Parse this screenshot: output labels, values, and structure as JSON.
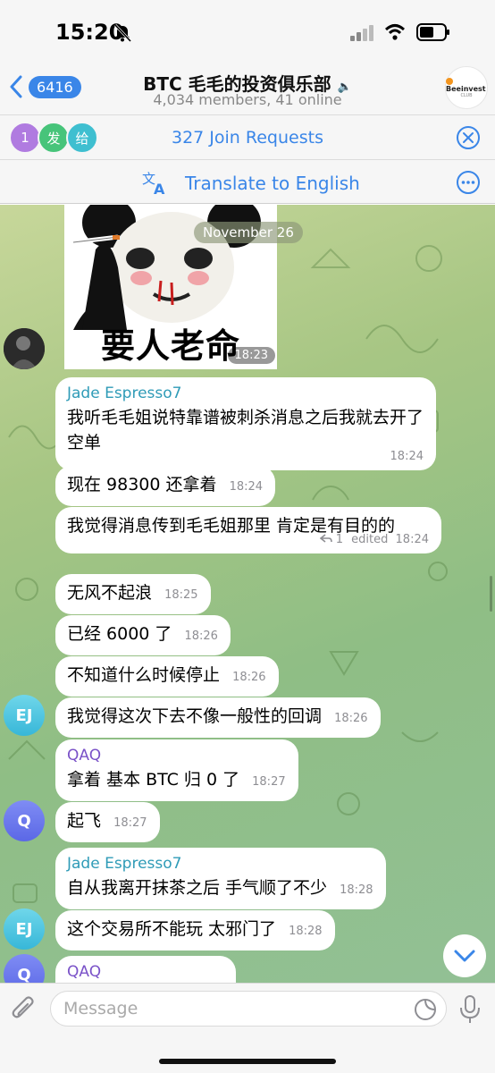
{
  "status": {
    "time": "15:20"
  },
  "header": {
    "back_count": "6416",
    "title": "BTC 毛毛的投资俱乐部",
    "subtitle": "4,034 members, 41 online",
    "logo_text": "Beeinvest",
    "logo_sub": "CLUB"
  },
  "join_bar": {
    "avatars": [
      {
        "text": "1",
        "color": "#b07be0"
      },
      {
        "text": "发",
        "color": "#47c47a"
      },
      {
        "text": "给",
        "color": "#3fbfd0"
      }
    ],
    "text": "327 Join Requests"
  },
  "translate_bar": {
    "text": "Translate to English"
  },
  "chat": {
    "date": "November 26",
    "sticker": {
      "caption": "要人老命",
      "time": "18:23"
    },
    "messages": [
      {
        "sender": "Jade Espresso7",
        "text": "我听毛毛姐说特靠谱被刺杀消息之后我就去开了空单",
        "time": "18:24"
      },
      {
        "text": "现在 98300 还拿着",
        "time": "18:24"
      },
      {
        "text": "我觉得消息传到毛毛姐那里 肯定是有目的的",
        "replies": "1",
        "edited": "edited",
        "time": "18:24"
      },
      {
        "text": "无风不起浪",
        "time": "18:25"
      },
      {
        "text": "已经 6000 了",
        "time": "18:26"
      },
      {
        "text": "不知道什么时候停止",
        "time": "18:26"
      },
      {
        "text": "我觉得这次下去不像一般性的回调",
        "time": "18:26",
        "avatar": "EJ"
      },
      {
        "sender": "QAQ",
        "text": "拿着 基本 BTC 归 0 了",
        "time": "18:27"
      },
      {
        "text": "起飞",
        "time": "18:27",
        "avatar": "Q"
      },
      {
        "sender": "Jade Espresso7",
        "text": "自从我离开抹茶之后 手气顺了不少",
        "time": "18:28"
      },
      {
        "text": "这个交易所不能玩 太邪门了",
        "time": "18:28",
        "avatar": "EJ"
      },
      {
        "sender": "QAQ",
        "avatar": "Q"
      }
    ]
  },
  "input": {
    "placeholder": "Message"
  },
  "colors": {
    "accent": "#3a86e8",
    "jade_name": "#2f9bb7",
    "qaq_name": "#7a52c8"
  }
}
